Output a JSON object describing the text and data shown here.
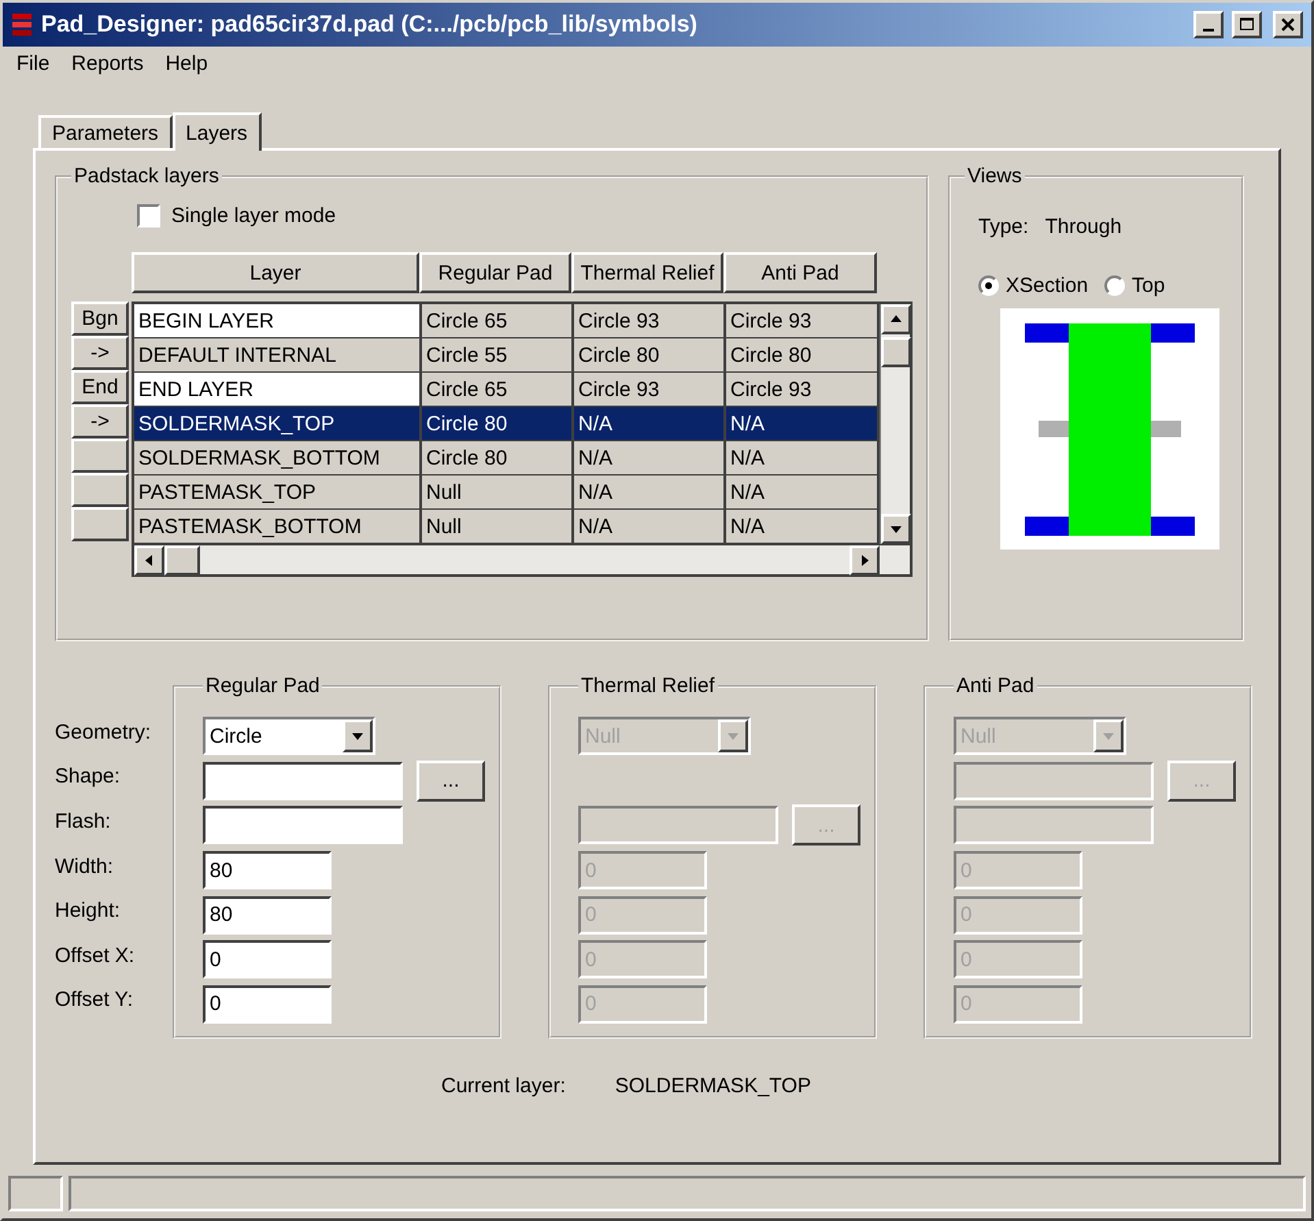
{
  "window": {
    "title": "Pad_Designer: pad65cir37d.pad (C:.../pcb/pcb_lib/symbols)"
  },
  "menu": [
    "File",
    "Reports",
    "Help"
  ],
  "tabs": [
    {
      "label": "Parameters",
      "selected": false
    },
    {
      "label": "Layers",
      "selected": true
    }
  ],
  "padstack_layers": {
    "title": "Padstack layers",
    "single_layer_mode": {
      "label": "Single layer mode",
      "checked": false
    },
    "columns": [
      "Layer",
      "Regular Pad",
      "Thermal Relief",
      "Anti Pad"
    ],
    "rows": [
      {
        "button": "Bgn",
        "editable": true,
        "selected": false,
        "cells": [
          "BEGIN LAYER",
          "Circle 65",
          "Circle 93",
          "Circle 93"
        ]
      },
      {
        "button": "->",
        "editable": false,
        "selected": false,
        "cells": [
          "DEFAULT INTERNAL",
          "Circle 55",
          "Circle 80",
          "Circle 80"
        ]
      },
      {
        "button": "End",
        "editable": true,
        "selected": false,
        "cells": [
          "END LAYER",
          "Circle 65",
          "Circle 93",
          "Circle 93"
        ]
      },
      {
        "button": "->",
        "editable": false,
        "selected": true,
        "cells": [
          "SOLDERMASK_TOP",
          "Circle 80",
          "N/A",
          "N/A"
        ]
      },
      {
        "editable": false,
        "selected": false,
        "cells": [
          "SOLDERMASK_BOTTOM",
          "Circle 80",
          "N/A",
          "N/A"
        ]
      },
      {
        "editable": false,
        "selected": false,
        "cells": [
          "PASTEMASK_TOP",
          "Null",
          "N/A",
          "N/A"
        ]
      },
      {
        "editable": false,
        "selected": false,
        "cells": [
          "PASTEMASK_BOTTOM",
          "Null",
          "N/A",
          "N/A"
        ]
      }
    ]
  },
  "views": {
    "title": "Views",
    "type_label": "Type:",
    "type_value": "Through",
    "options": [
      {
        "label": "XSection",
        "selected": true
      },
      {
        "label": "Top",
        "selected": false
      }
    ]
  },
  "field_labels": [
    "Geometry:",
    "Shape:",
    "Flash:",
    "Width:",
    "Height:",
    "Offset X:",
    "Offset Y:"
  ],
  "pad_groups": [
    {
      "title": "Regular Pad",
      "geometry": "Circle",
      "disabled": false,
      "fields": [
        {
          "kind": "wide",
          "button": "..."
        },
        {
          "kind": "wide"
        },
        {
          "kind": "narrow",
          "value": "80"
        },
        {
          "kind": "narrow",
          "value": "80"
        },
        {
          "kind": "narrow",
          "value": "0"
        },
        {
          "kind": "narrow",
          "value": "0"
        }
      ]
    },
    {
      "title": "Thermal Relief",
      "geometry": "Null",
      "disabled": true,
      "fields": [
        {
          "kind": "blank"
        },
        {
          "kind": "wide",
          "button": "..."
        },
        {
          "kind": "narrow",
          "value": "0"
        },
        {
          "kind": "narrow",
          "value": "0"
        },
        {
          "kind": "narrow",
          "value": "0"
        },
        {
          "kind": "narrow",
          "value": "0"
        }
      ]
    },
    {
      "title": "Anti Pad",
      "geometry": "Null",
      "disabled": true,
      "fields": [
        {
          "kind": "wide",
          "button": "..."
        },
        {
          "kind": "wide"
        },
        {
          "kind": "narrow",
          "value": "0"
        },
        {
          "kind": "narrow",
          "value": "0"
        },
        {
          "kind": "narrow",
          "value": "0"
        },
        {
          "kind": "narrow",
          "value": "0"
        }
      ]
    }
  ],
  "current_layer": {
    "label": "Current layer:",
    "value": "SOLDERMASK_TOP"
  }
}
